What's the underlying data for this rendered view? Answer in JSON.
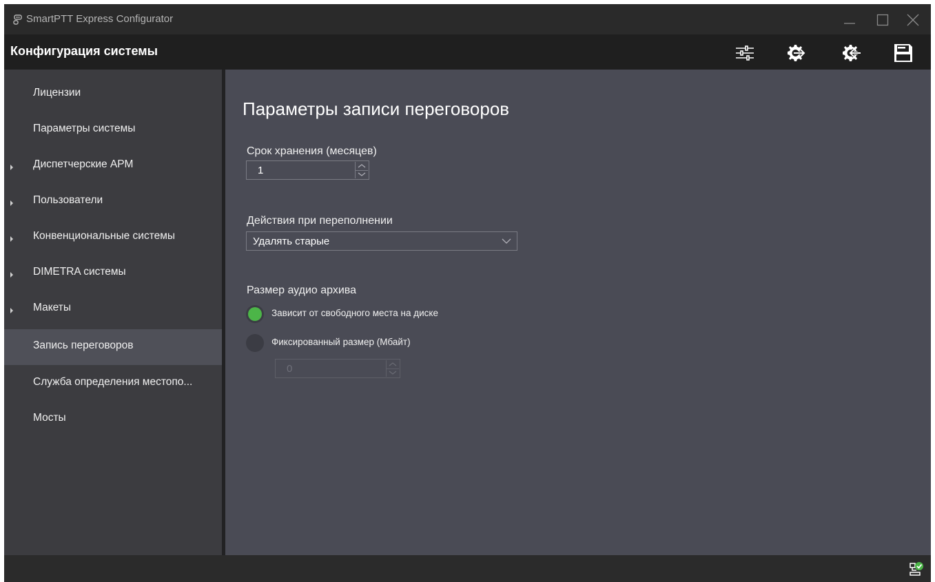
{
  "window": {
    "title": "SmartPTT Express Configurator",
    "icons": {
      "app": "radio-handset-icon",
      "minimize": "minimize-icon",
      "maximize": "maximize-icon",
      "close": "close-icon"
    }
  },
  "header": {
    "title": "Конфигурация системы",
    "toolbar": [
      {
        "name": "settings-sliders-icon"
      },
      {
        "name": "export-config-icon"
      },
      {
        "name": "import-config-icon"
      },
      {
        "name": "save-icon"
      }
    ]
  },
  "sidebar": {
    "items": [
      {
        "label": "Лицензии",
        "expandable": false,
        "selected": false
      },
      {
        "label": "Параметры системы",
        "expandable": false,
        "selected": false
      },
      {
        "label": "Диспетчерские АРМ",
        "expandable": true,
        "selected": false
      },
      {
        "label": "Пользователи",
        "expandable": true,
        "selected": false
      },
      {
        "label": "Конвенциональные системы",
        "expandable": true,
        "selected": false
      },
      {
        "label": "DIMETRA системы",
        "expandable": true,
        "selected": false
      },
      {
        "label": "Макеты",
        "expandable": true,
        "selected": false
      },
      {
        "label": "Запись переговоров",
        "expandable": false,
        "selected": true
      },
      {
        "label": "Служба определения местопо...",
        "expandable": false,
        "selected": false
      },
      {
        "label": "Мосты",
        "expandable": false,
        "selected": false
      }
    ]
  },
  "main": {
    "title": "Параметры записи переговоров",
    "retention": {
      "label": "Срок хранения (месяцев)",
      "value": "1"
    },
    "overflow": {
      "label": "Действия при переполнении",
      "value": "Удалять старые"
    },
    "archive": {
      "label": "Размер аудио архива",
      "options": [
        {
          "label": "Зависит от свободного места на диске",
          "checked": true
        },
        {
          "label": "Фиксированный размер (Мбайт)",
          "checked": false
        }
      ],
      "fixed_size_value": "0"
    }
  },
  "statusbar": {
    "icon": "connection-ok-icon"
  },
  "colors": {
    "accent_green": "#4cb548",
    "sidebar_bg": "#3c3c40",
    "main_bg": "#4a4b55",
    "header_bg": "#1f1f1f",
    "selected_bg": "#4f5058"
  }
}
